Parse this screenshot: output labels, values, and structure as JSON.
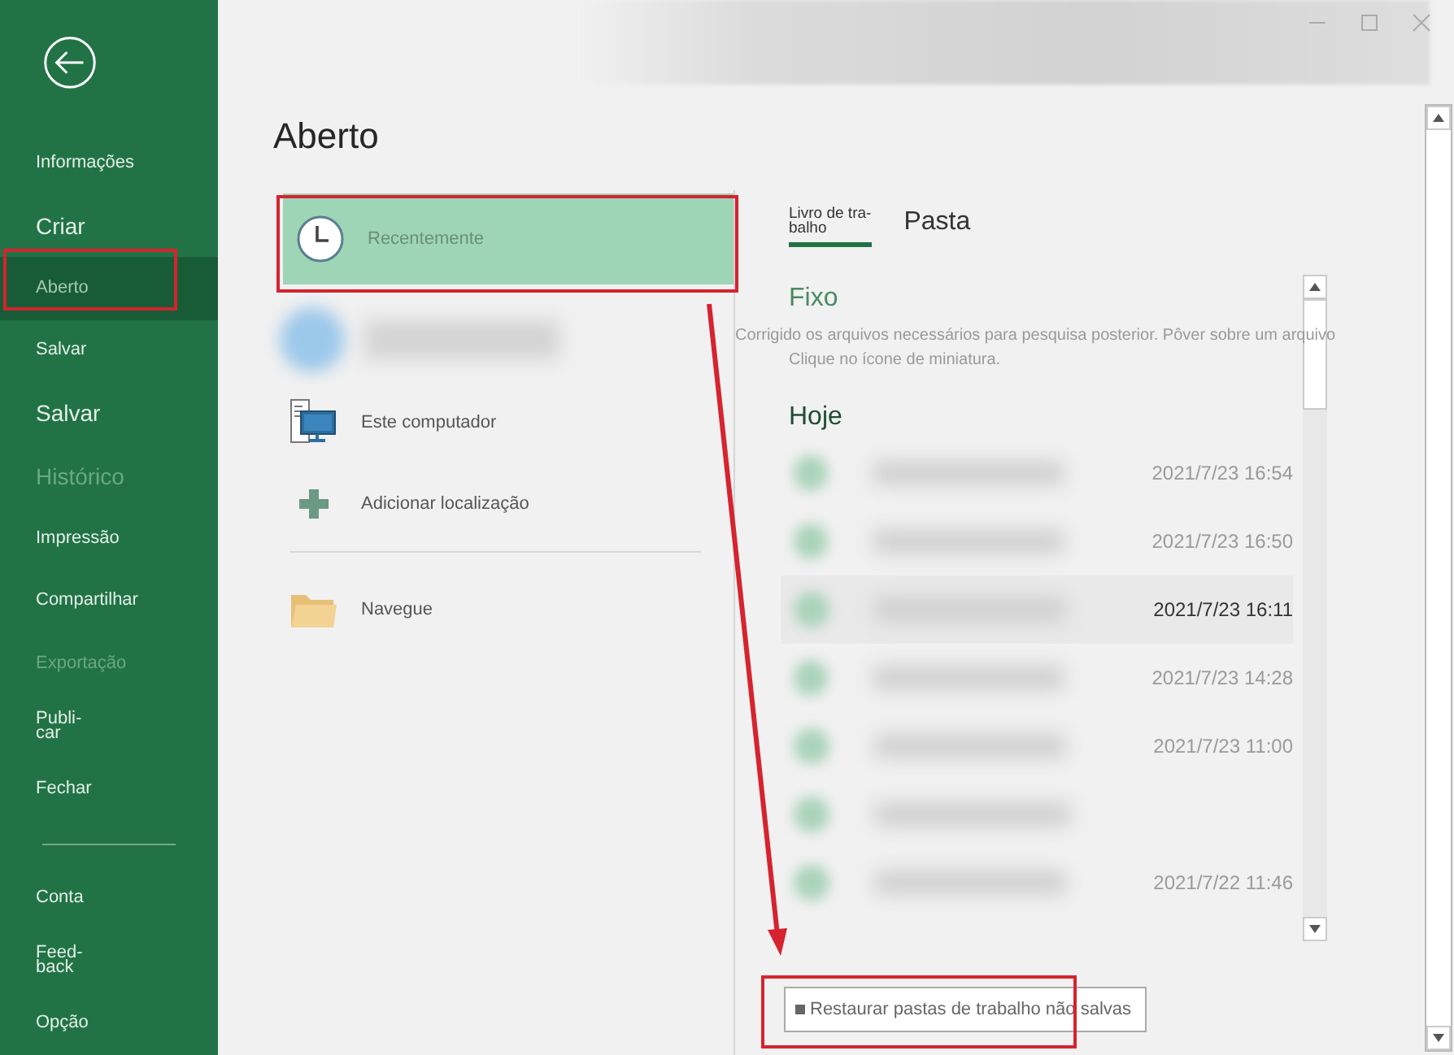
{
  "sidebar": {
    "items": [
      {
        "kind": "small",
        "label": "Informações",
        "selected": false,
        "disabled": false
      },
      {
        "kind": "large",
        "label": "Criar",
        "selected": false,
        "disabled": false
      },
      {
        "kind": "small",
        "label": "Aberto",
        "selected": true,
        "disabled": false
      },
      {
        "kind": "small",
        "label": "Salvar",
        "selected": false,
        "disabled": false
      },
      {
        "kind": "large",
        "label": "Salvar",
        "selected": false,
        "disabled": false
      },
      {
        "kind": "large",
        "label": "Histórico",
        "selected": false,
        "disabled": true
      },
      {
        "kind": "small",
        "label": "Impressão",
        "selected": false,
        "disabled": false
      },
      {
        "kind": "small",
        "label": "Compartilhar",
        "selected": false,
        "disabled": false
      },
      {
        "kind": "small",
        "label": "Exportação",
        "selected": false,
        "disabled": true
      },
      {
        "kind": "small",
        "label": "Publi-\ncar",
        "selected": false,
        "disabled": false
      },
      {
        "kind": "small",
        "label": "Fechar",
        "selected": false,
        "disabled": false
      },
      {
        "kind": "divider"
      },
      {
        "kind": "small",
        "label": "Conta",
        "selected": false,
        "disabled": false
      },
      {
        "kind": "small",
        "label": "Feed-\nback",
        "selected": false,
        "disabled": false
      },
      {
        "kind": "small",
        "label": "Opção",
        "selected": false,
        "disabled": false
      }
    ]
  },
  "page_title": "Aberto",
  "locations": [
    {
      "kind": "recent",
      "label": "Recentemente",
      "selected": true
    },
    {
      "kind": "account",
      "selected": false
    },
    {
      "kind": "computer",
      "label": "Este computador",
      "selected": false
    },
    {
      "kind": "add",
      "label": "Adicionar localização",
      "selected": false
    },
    {
      "kind": "browse",
      "label": "Navegue",
      "selected": false
    }
  ],
  "tabs": [
    {
      "kind": "compact",
      "label": "Livro de tra-\nbalho",
      "selected": true
    },
    {
      "kind": "normal",
      "label": "Pasta",
      "selected": false
    }
  ],
  "pinned": {
    "heading": "Fixo",
    "hint_lines": [
      "Corrigido os arquivos necessários para pesquisa posterior. Pôver sobre um arquivo",
      "Clique no ícone de miniatura."
    ]
  },
  "today": {
    "heading": "Hoje",
    "files": [
      {
        "kind": "dated",
        "date": "2021/7/23 16:54",
        "selected": false
      },
      {
        "kind": "dated",
        "date": "2021/7/23 16:50",
        "selected": false
      },
      {
        "kind": "dated",
        "date": "2021/7/23 16:11",
        "selected": true
      },
      {
        "kind": "dated",
        "date": "2021/7/23 14:28",
        "selected": false
      },
      {
        "kind": "dated",
        "date": "2021/7/23 11:00",
        "selected": false
      },
      {
        "kind": "undated"
      },
      {
        "kind": "dated",
        "date": "2021/7/22 11:46",
        "selected": false
      }
    ]
  },
  "restore_button": {
    "label": "Restaurar pastas de trabalho não salvas"
  }
}
